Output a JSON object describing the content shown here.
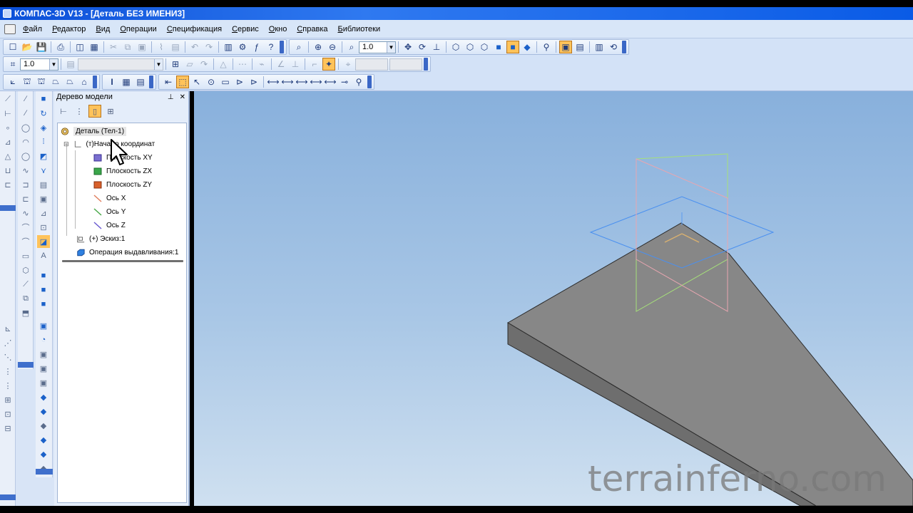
{
  "window": {
    "title": "КОМПАС-3D V13 - [Деталь БЕЗ ИМЕНИ3]"
  },
  "menu": {
    "items": [
      "Файл",
      "Редактор",
      "Вид",
      "Операции",
      "Спецификация",
      "Сервис",
      "Окно",
      "Справка",
      "Библиотеки"
    ]
  },
  "toolbar": {
    "zoom_value": "1.0",
    "step_value": "1.0"
  },
  "tree_panel": {
    "title": "Дерево модели",
    "pin_icon": "pin-icon",
    "close_icon": "close-icon",
    "items": [
      {
        "label": "Деталь (Тел-1)",
        "icon": "part-icon"
      },
      {
        "label": "(т)Начало координат",
        "icon": "origin-icon"
      },
      {
        "label": "Плоскость XY",
        "icon": "plane-xy-icon",
        "color": "#7a6fd0"
      },
      {
        "label": "Плоскость ZX",
        "icon": "plane-zx-icon",
        "color": "#3aa64a"
      },
      {
        "label": "Плоскость ZY",
        "icon": "plane-zy-icon",
        "color": "#d8602a"
      },
      {
        "label": "Ось X",
        "icon": "axis-x-icon",
        "color": "#e08060"
      },
      {
        "label": "Ось Y",
        "icon": "axis-y-icon",
        "color": "#4aa84a"
      },
      {
        "label": "Ось Z",
        "icon": "axis-z-icon",
        "color": "#6a5ad0"
      },
      {
        "label": "(+) Эскиз:1",
        "icon": "sketch-icon"
      },
      {
        "label": "Операция выдавливания:1",
        "icon": "extrude-icon"
      }
    ]
  },
  "viewport": {
    "watermark": "terrainferno.com",
    "colors": {
      "plane_xy": "#4a90f0",
      "plane_zx": "#a6e07a",
      "plane_zy": "#e8a6b0",
      "solid_top": "#878787",
      "solid_side": "#6e6e6e"
    }
  }
}
